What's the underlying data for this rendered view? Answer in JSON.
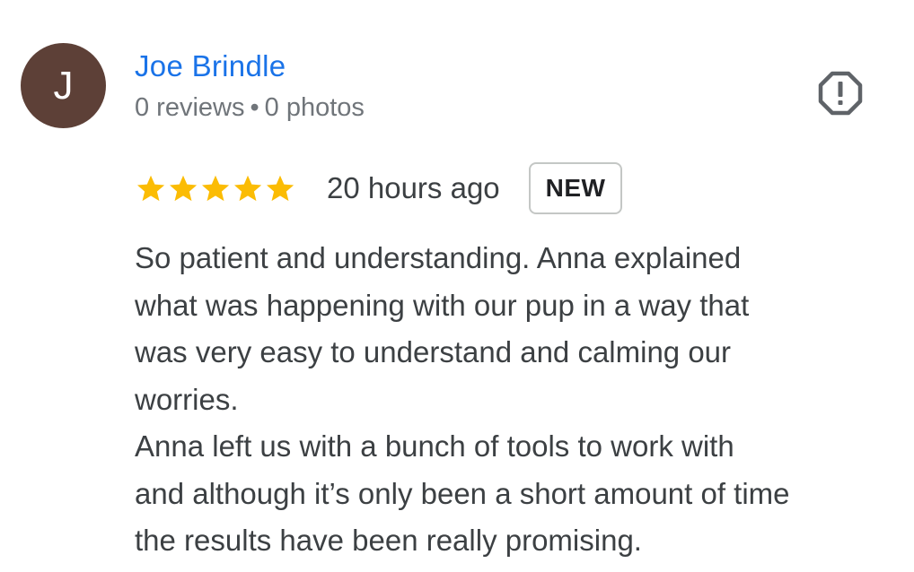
{
  "author": {
    "initial": "J",
    "name": "Joe Brindle",
    "reviews_count": "0 reviews",
    "separator": "•",
    "photos_count": "0 photos",
    "avatar_color": "#5d4037",
    "name_color": "#1a73e8"
  },
  "actions": {
    "report_icon": "report-flag-icon"
  },
  "rating": {
    "stars": 5,
    "max_stars": 5,
    "star_color": "#fbbc04",
    "star_icon": "star-icon"
  },
  "review": {
    "time_ago": "20 hours ago",
    "badge": "NEW",
    "lines": [
      "So patient and understanding. Anna explained",
      "what was happening with our pup in a way that",
      "was very easy to understand and calming our",
      "worries.",
      "Anna left us with a bunch of tools to work with",
      "and although it’s only been a short amount of time",
      "the results have been really promising."
    ]
  }
}
